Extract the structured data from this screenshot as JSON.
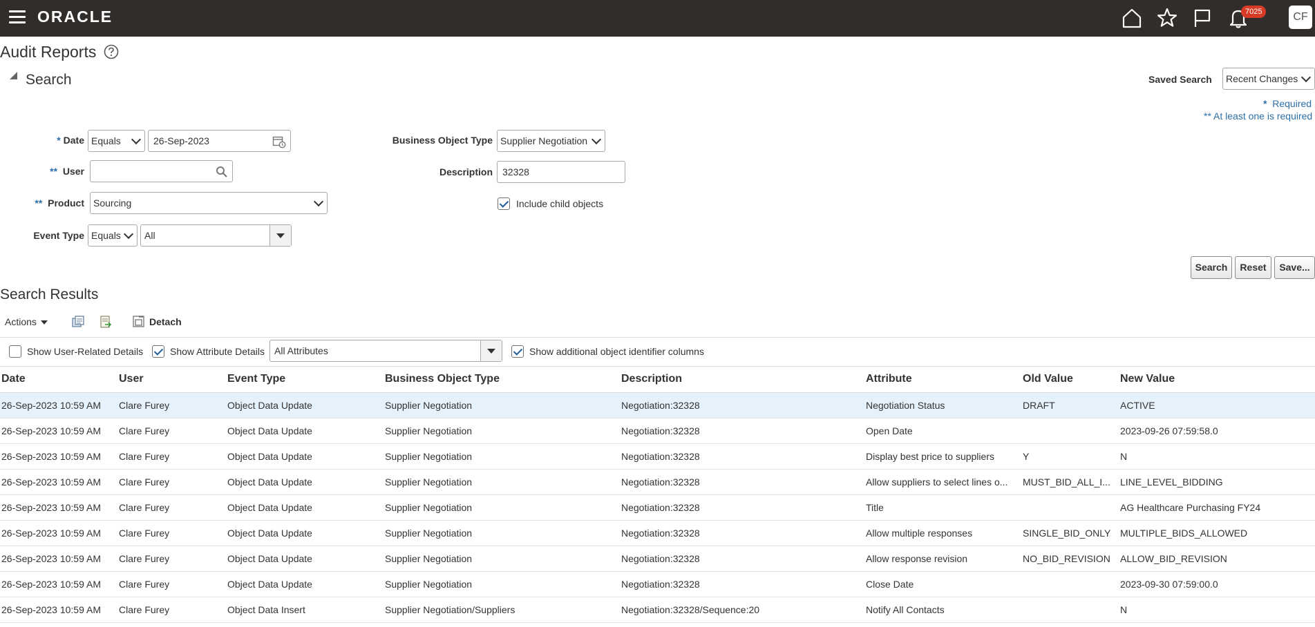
{
  "app": {
    "logo": "ORACLE",
    "notifications_count": "7025",
    "avatar_initials": "CF"
  },
  "page": {
    "title": "Audit Reports"
  },
  "search": {
    "section_title": "Search",
    "saved_search_label": "Saved Search",
    "saved_search_value": "Recent Changes",
    "required_note": "Required",
    "required_star": "*",
    "at_least_one_note": "** At least one is required",
    "date": {
      "star": "*",
      "label": "Date",
      "operator": "Equals",
      "value": "26-Sep-2023"
    },
    "user": {
      "star": "**",
      "label": "User",
      "value": ""
    },
    "product": {
      "star": "**",
      "label": "Product",
      "value": "Sourcing"
    },
    "event_type": {
      "label": "Event Type",
      "operator": "Equals",
      "value": "All"
    },
    "business_object_type": {
      "label": "Business Object Type",
      "value": "Supplier Negotiation"
    },
    "description": {
      "label": "Description",
      "value": "32328"
    },
    "include_child_objects": {
      "label": "Include child objects",
      "checked": true
    },
    "buttons": {
      "search": "Search",
      "reset": "Reset",
      "save": "Save..."
    }
  },
  "results": {
    "title": "Search Results",
    "actions_label": "Actions",
    "detach_label": "Detach",
    "show_user_related": {
      "label": "Show User-Related Details",
      "checked": false
    },
    "show_attribute_details": {
      "label": "Show Attribute Details",
      "checked": true
    },
    "attributes_select": "All Attributes",
    "show_additional_columns": {
      "label": "Show additional object identifier columns",
      "checked": true
    },
    "columns": [
      "Date",
      "User",
      "Event Type",
      "Business Object Type",
      "Description",
      "Attribute",
      "Old Value",
      "New Value"
    ],
    "rows": [
      [
        "26-Sep-2023 10:59 AM",
        "Clare Furey",
        "Object Data Update",
        "Supplier Negotiation",
        "Negotiation:32328",
        "Negotiation Status",
        "DRAFT",
        "ACTIVE"
      ],
      [
        "26-Sep-2023 10:59 AM",
        "Clare Furey",
        "Object Data Update",
        "Supplier Negotiation",
        "Negotiation:32328",
        "Open Date",
        "",
        "2023-09-26 07:59:58.0"
      ],
      [
        "26-Sep-2023 10:59 AM",
        "Clare Furey",
        "Object Data Update",
        "Supplier Negotiation",
        "Negotiation:32328",
        "Display best price to suppliers",
        "Y",
        "N"
      ],
      [
        "26-Sep-2023 10:59 AM",
        "Clare Furey",
        "Object Data Update",
        "Supplier Negotiation",
        "Negotiation:32328",
        "Allow suppliers to select lines o...",
        "MUST_BID_ALL_I...",
        "LINE_LEVEL_BIDDING"
      ],
      [
        "26-Sep-2023 10:59 AM",
        "Clare Furey",
        "Object Data Update",
        "Supplier Negotiation",
        "Negotiation:32328",
        "Title",
        "",
        "AG Healthcare Purchasing FY24"
      ],
      [
        "26-Sep-2023 10:59 AM",
        "Clare Furey",
        "Object Data Update",
        "Supplier Negotiation",
        "Negotiation:32328",
        "Allow multiple responses",
        "SINGLE_BID_ONLY",
        "MULTIPLE_BIDS_ALLOWED"
      ],
      [
        "26-Sep-2023 10:59 AM",
        "Clare Furey",
        "Object Data Update",
        "Supplier Negotiation",
        "Negotiation:32328",
        "Allow response revision",
        "NO_BID_REVISION",
        "ALLOW_BID_REVISION"
      ],
      [
        "26-Sep-2023 10:59 AM",
        "Clare Furey",
        "Object Data Update",
        "Supplier Negotiation",
        "Negotiation:32328",
        "Close Date",
        "",
        "2023-09-30 07:59:00.0"
      ],
      [
        "26-Sep-2023 10:59 AM",
        "Clare Furey",
        "Object Data Insert",
        "Supplier Negotiation/Suppliers",
        "Negotiation:32328/Sequence:20",
        "Notify All Contacts",
        "",
        "N"
      ]
    ],
    "selected_row": 0
  },
  "colors": {
    "topbar": "#312d2a",
    "accent": "#2b6fa8",
    "badge": "#d63b25",
    "row_selected": "#e6f2fb"
  },
  "icons": [
    "hamburger-icon",
    "home-icon",
    "star-icon",
    "flag-icon",
    "bell-icon",
    "help-icon",
    "calendar-icon",
    "search-icon",
    "chevron-down-icon",
    "dropdown-arrow-icon",
    "checkbox-icon",
    "export-icon",
    "detach-icon"
  ]
}
